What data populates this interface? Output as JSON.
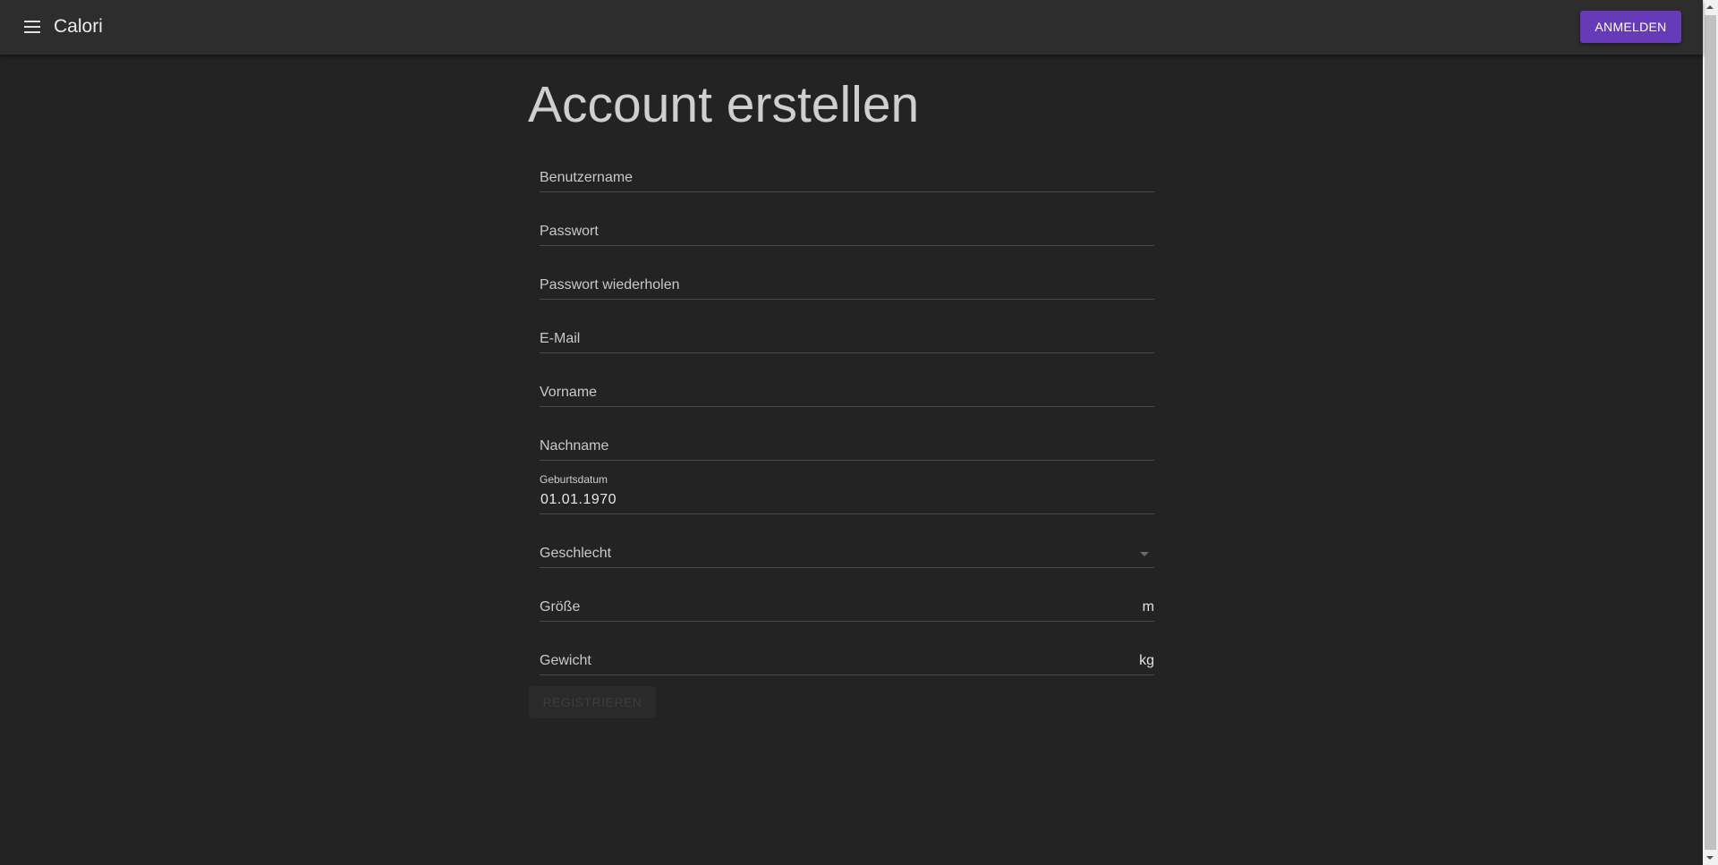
{
  "app": {
    "title": "Calori",
    "login_label": "ANMELDEN"
  },
  "page": {
    "title": "Account erstellen"
  },
  "form": {
    "username": {
      "label": "Benutzername"
    },
    "password": {
      "label": "Passwort"
    },
    "password_repeat": {
      "label": "Passwort wiederholen"
    },
    "email": {
      "label": "E-Mail"
    },
    "first_name": {
      "label": "Vorname"
    },
    "last_name": {
      "label": "Nachname"
    },
    "birthdate": {
      "label": "Geburtsdatum",
      "value": "01.01.1970"
    },
    "gender": {
      "label": "Geschlecht"
    },
    "height": {
      "label": "Größe",
      "suffix": "m"
    },
    "weight": {
      "label": "Gewicht",
      "suffix": "kg"
    },
    "submit_label": "REGISTRIEREN"
  },
  "colors": {
    "background": "#232323",
    "appbar": "#2d2d2d",
    "accent": "#673ab7"
  },
  "icons": {
    "menu": "menu-icon",
    "dropdown": "chevron-down-icon"
  }
}
